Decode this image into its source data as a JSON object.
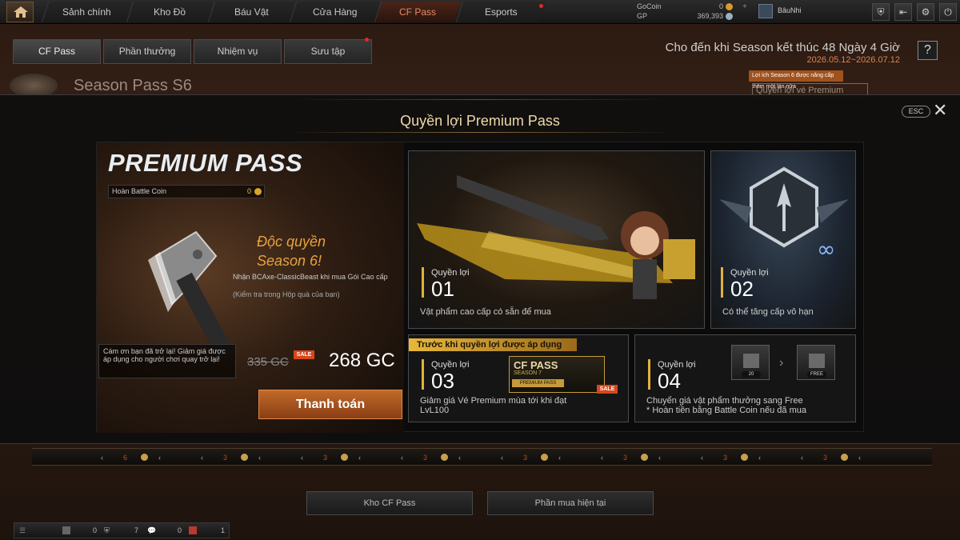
{
  "nav": {
    "tabs": [
      "Sảnh chính",
      "Kho Đồ",
      "Báu Vật",
      "Cửa Hàng",
      "CF Pass",
      "Esports"
    ],
    "active_tab": "CF Pass"
  },
  "currency": {
    "gocoin_label": "GoCoin",
    "gocoin_value": "0",
    "gp_label": "GP",
    "gp_value": "369,393"
  },
  "user": {
    "name": "BâuNhi"
  },
  "subtabs": [
    "CF Pass",
    "Phần thưởng",
    "Nhiệm vụ",
    "Sưu tập"
  ],
  "season": {
    "end_text": "Cho đến khi Season kết thúc 48 Ngày 4 Giờ",
    "date_range": "2026.05.12~2026.07.12",
    "help_label": "?",
    "bg_title": "Season Pass S6",
    "bg_ribbon": "Lợi ích Season 6 được nâng cấp thêm một lần nữa",
    "bg_right": "Quyền lợi vé Premium"
  },
  "modal": {
    "title": "Quyền lợi Premium Pass",
    "esc_label": "ESC",
    "close_label": "✕",
    "premium": {
      "title": "PREMIUM PASS",
      "refund_label": "Hoàn Battle Coin",
      "refund_value": "0",
      "exclusive_line1": "Độc quyền",
      "exclusive_line2": "Season 6!",
      "exclusive_desc": "Nhận BCAxe-ClassicBeast khi mua Gói Cao cấp",
      "exclusive_note": "(Kiểm tra trong Hộp quà của bạn)",
      "returner_text": "Cám ơn bạn đã trở lại! Giảm giá được áp dụng cho người chơi quay trở lại!",
      "old_price": "335 GC",
      "sale_tag": "SALE",
      "new_price": "268 GC",
      "pay_button": "Thanh toán"
    },
    "benefits": [
      {
        "label": "Quyền lợi",
        "number": "01",
        "desc": "Vật phẩm cao cấp có sẵn để mua"
      },
      {
        "label": "Quyền lợi",
        "number": "02",
        "desc": "Có thể tăng cấp vô hạn"
      },
      {
        "label": "Quyền lợi",
        "number": "03",
        "desc": "Giảm giá Vé Premium mùa tới khi đạt LvL100",
        "header": "Trước khi quyền lợi được áp dụng",
        "pass_title": "CF PASS",
        "pass_season": "SEASON 7",
        "pass_premium": "PREMIUM PASS",
        "sale_tag": "SALE"
      },
      {
        "label": "Quyền lợi",
        "number": "04",
        "desc_line1": "Chuyển giá vật phẩm thưởng sang Free",
        "desc_line2": "* Hoàn tiền bằng Battle Coin nếu đã mua",
        "box_left_value": "20",
        "box_right_value": "FREE"
      }
    ]
  },
  "track": [
    {
      "value": "6"
    },
    {
      "value": "3"
    },
    {
      "value": "3"
    },
    {
      "value": "3"
    },
    {
      "value": "3"
    },
    {
      "value": "3"
    },
    {
      "value": "3"
    },
    {
      "value": "3"
    },
    {
      "value": "3"
    }
  ],
  "lower_buttons": [
    "Kho CF Pass",
    "Phần mua hiện tại"
  ],
  "bottom_bar": {
    "c1": "0",
    "c2": "7",
    "c3": "0",
    "c4": "1"
  }
}
